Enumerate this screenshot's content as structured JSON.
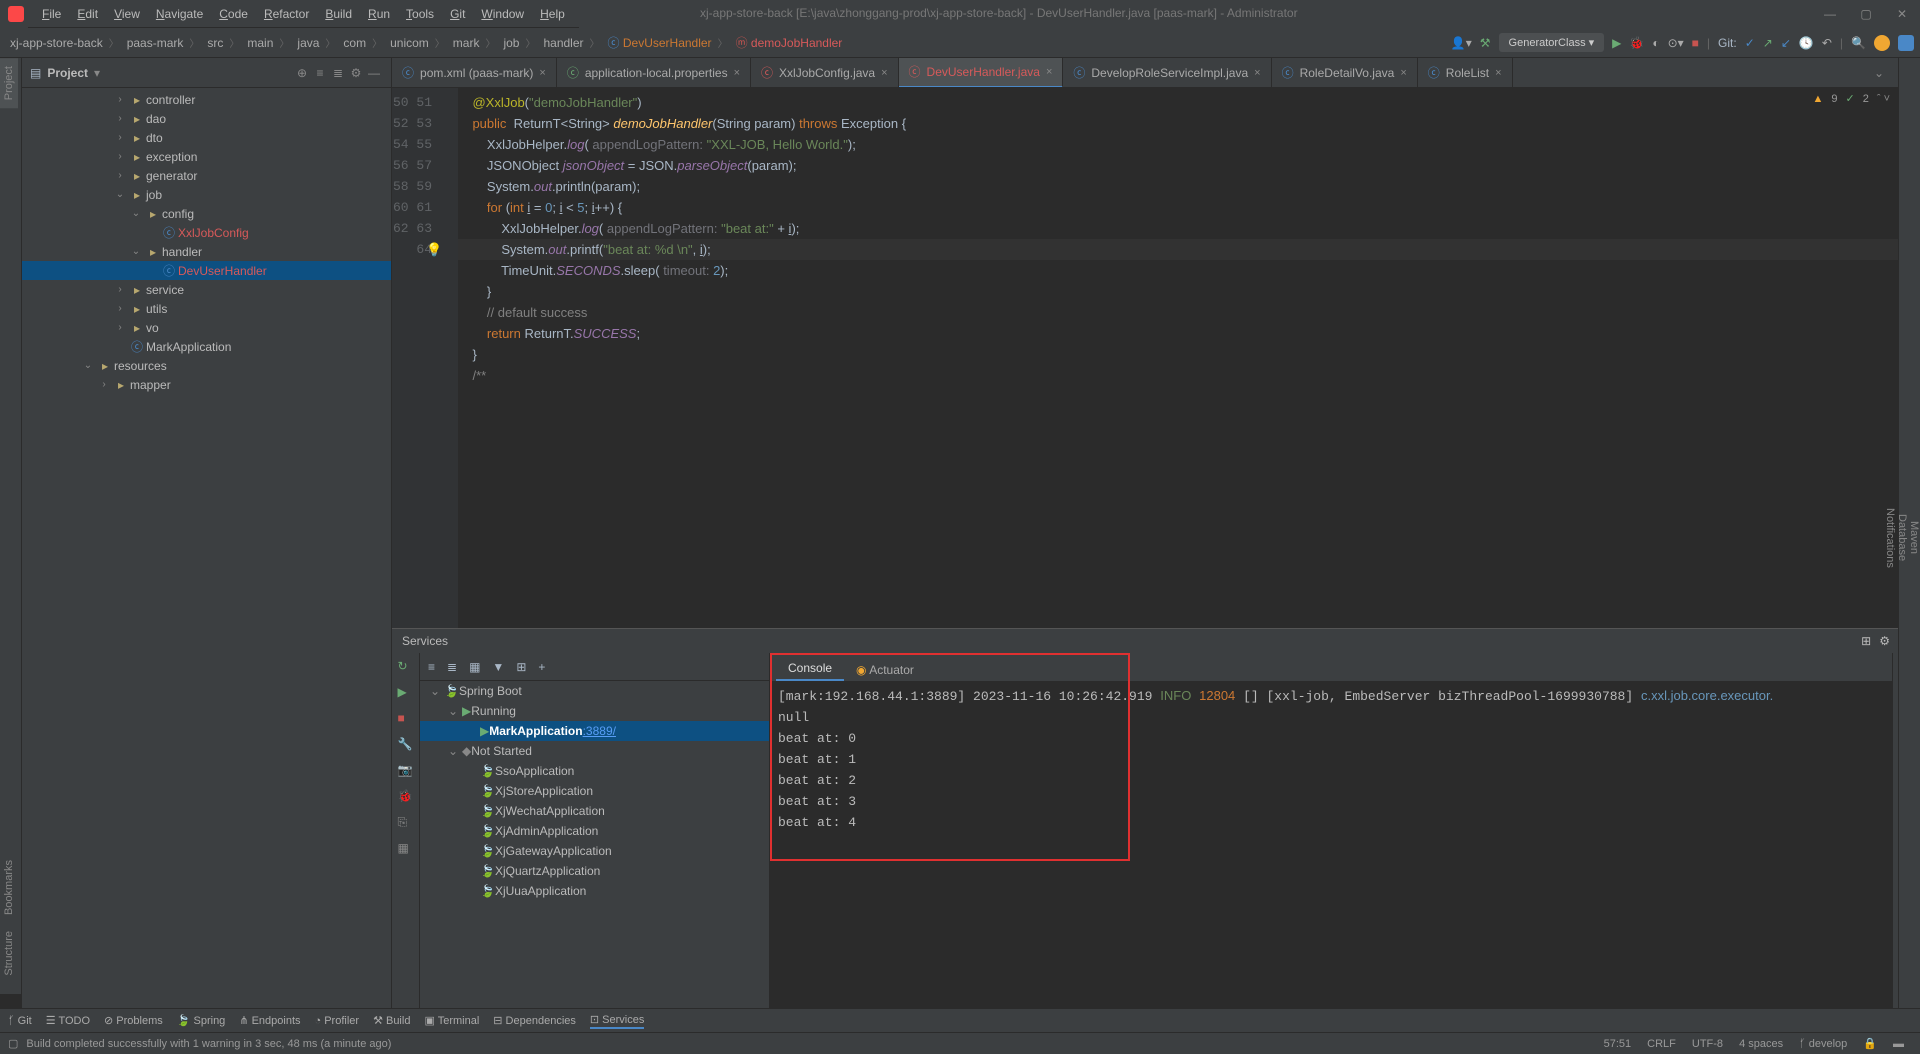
{
  "window": {
    "title": "xj-app-store-back [E:\\java\\zhonggang-prod\\xj-app-store-back] - DevUserHandler.java [paas-mark] - Administrator"
  },
  "menu": [
    "File",
    "Edit",
    "View",
    "Navigate",
    "Code",
    "Refactor",
    "Build",
    "Run",
    "Tools",
    "Git",
    "Window",
    "Help"
  ],
  "breadcrumbs": [
    "xj-app-store-back",
    "paas-mark",
    "src",
    "main",
    "java",
    "com",
    "unicom",
    "mark",
    "job",
    "handler",
    "DevUserHandler",
    "demoJobHandler"
  ],
  "run_config": "GeneratorClass",
  "git_label": "Git:",
  "project": {
    "title": "Project",
    "tree": [
      {
        "indent": 5,
        "arrow": ">",
        "icon": "dir",
        "label": "controller"
      },
      {
        "indent": 5,
        "arrow": ">",
        "icon": "dir",
        "label": "dao"
      },
      {
        "indent": 5,
        "arrow": ">",
        "icon": "dir",
        "label": "dto"
      },
      {
        "indent": 5,
        "arrow": ">",
        "icon": "dir",
        "label": "exception"
      },
      {
        "indent": 5,
        "arrow": ">",
        "icon": "dir",
        "label": "generator"
      },
      {
        "indent": 5,
        "arrow": "v",
        "icon": "dir",
        "label": "job"
      },
      {
        "indent": 6,
        "arrow": "v",
        "icon": "dir",
        "label": "config"
      },
      {
        "indent": 7,
        "arrow": "",
        "icon": "c",
        "label": "XxlJobConfig",
        "orange": true
      },
      {
        "indent": 6,
        "arrow": "v",
        "icon": "dir",
        "label": "handler"
      },
      {
        "indent": 7,
        "arrow": "",
        "icon": "c",
        "label": "DevUserHandler",
        "orange": true,
        "sel": true
      },
      {
        "indent": 5,
        "arrow": ">",
        "icon": "dir",
        "label": "service"
      },
      {
        "indent": 5,
        "arrow": ">",
        "icon": "dir",
        "label": "utils"
      },
      {
        "indent": 5,
        "arrow": ">",
        "icon": "dir",
        "label": "vo"
      },
      {
        "indent": 5,
        "arrow": "",
        "icon": "c",
        "label": "MarkApplication"
      },
      {
        "indent": 3,
        "arrow": "v",
        "icon": "dir",
        "label": "resources"
      },
      {
        "indent": 4,
        "arrow": ">",
        "icon": "dir",
        "label": "mapper"
      }
    ]
  },
  "tabs": [
    {
      "label": "pom.xml (paas-mark)",
      "color": "#4a88c7",
      "icon": "m"
    },
    {
      "label": "application-local.properties",
      "color": "#6aab73",
      "icon": "⚙"
    },
    {
      "label": "XxlJobConfig.java",
      "color": "#d75a5a",
      "icon": "c"
    },
    {
      "label": "DevUserHandler.java",
      "color": "#d75a5a",
      "icon": "c",
      "active": true
    },
    {
      "label": "DevelopRoleServiceImpl.java",
      "color": "#4a88c7",
      "icon": "c"
    },
    {
      "label": "RoleDetailVo.java",
      "color": "#4a88c7",
      "icon": "c"
    },
    {
      "label": "RoleList",
      "color": "#4a88c7",
      "icon": "c"
    }
  ],
  "editor_warnings": {
    "warn": "9",
    "ok": "2"
  },
  "code_lines": [
    {
      "n": 50,
      "html": "    <span class='ann'>@XxlJob</span>(<span class='str'>\"demoJobHandler\"</span>)"
    },
    {
      "n": 51,
      "html": "    <span class='kw'>public</span>  ReturnT&lt;String&gt; <span class='fn'>demoJobHandler</span>(String param) <span class='kw'>throws</span> Exception {"
    },
    {
      "n": 52,
      "html": "        XxlJobHelper.<span class='fld'>log</span>( <span class='param'>appendLogPattern:</span> <span class='str'>\"XXL-JOB, Hello World.\"</span>);"
    },
    {
      "n": 53,
      "html": "        JSONObject <span class='fld'>jsonObject</span> = JSON.<span class='fld'>parseObject</span>(param);"
    },
    {
      "n": 54,
      "html": "        System.<span class='fld'>out</span>.println(param);"
    },
    {
      "n": 55,
      "html": "        <span class='kw'>for</span> (<span class='kw'>int</span> <u>i</u> = <span class='num'>0</span>; <u>i</u> &lt; <span class='num'>5</span>; <u>i</u>++) {"
    },
    {
      "n": 56,
      "html": "            XxlJobHelper.<span class='fld'>log</span>( <span class='param'>appendLogPattern:</span> <span class='str'>\"beat at:\"</span> + <u>i</u>);"
    },
    {
      "n": 57,
      "html": "            System.<span class='fld'>out</span>.printf(<span class='str'>\"beat at: %d \\n\"</span>, <u>i</u>);",
      "hl": true,
      "bulb": true
    },
    {
      "n": 58,
      "html": "            TimeUnit.<span class='fld'>SECONDS</span>.sleep( <span class='param'>timeout:</span> <span class='num'>2</span>);"
    },
    {
      "n": 59,
      "html": "        }"
    },
    {
      "n": 60,
      "html": "        <span class='cmt'>// default success</span>"
    },
    {
      "n": 61,
      "html": "        <span class='kw'>return</span> ReturnT.<span class='fld'>SUCCESS</span>;"
    },
    {
      "n": 62,
      "html": "    }"
    },
    {
      "n": 63,
      "html": ""
    },
    {
      "n": 64,
      "html": "    <span class='cmt'>/**</span>"
    }
  ],
  "services": {
    "title": "Services",
    "console_tab": "Console",
    "actuator_tab": "Actuator",
    "tree": [
      {
        "indent": 0,
        "arrow": "v",
        "icon": "🍃",
        "label": "Spring Boot"
      },
      {
        "indent": 1,
        "arrow": "v",
        "icon": "▶",
        "label": "Running",
        "green": true
      },
      {
        "indent": 2,
        "arrow": "",
        "icon": "▶",
        "label": "MarkApplication",
        "link": ":3889/",
        "sel": true,
        "green": true,
        "bold": true
      },
      {
        "indent": 1,
        "arrow": "v",
        "icon": "◆",
        "label": "Not Started"
      },
      {
        "indent": 2,
        "arrow": "",
        "icon": "🍃",
        "label": "SsoApplication"
      },
      {
        "indent": 2,
        "arrow": "",
        "icon": "🍃",
        "label": "XjStoreApplication"
      },
      {
        "indent": 2,
        "arrow": "",
        "icon": "🍃",
        "label": "XjWechatApplication"
      },
      {
        "indent": 2,
        "arrow": "",
        "icon": "🍃",
        "label": "XjAdminApplication"
      },
      {
        "indent": 2,
        "arrow": "",
        "icon": "🍃",
        "label": "XjGatewayApplication"
      },
      {
        "indent": 2,
        "arrow": "",
        "icon": "🍃",
        "label": "XjQuartzApplication"
      },
      {
        "indent": 2,
        "arrow": "",
        "icon": "🍃",
        "label": "XjUuaApplication"
      }
    ],
    "console": "[mark:192.168.44.1:3889] 2023-11-16 10:26:42.919 <span class='log-info'>INFO</span> <span class='log-num'>12804</span> [] [xxl-job, EmbedServer bizThreadPool-1699930788] <span class='log-cls'>c.xxl.job.core.executor.</span>\nnull\nbeat at: 0\nbeat at: 1\nbeat at: 2\nbeat at: 3\nbeat at: 4"
  },
  "bottom_tabs": [
    "Git",
    "TODO",
    "Problems",
    "Spring",
    "Endpoints",
    "Profiler",
    "Build",
    "Terminal",
    "Dependencies",
    "Services"
  ],
  "status": {
    "msg": "Build completed successfully with 1 warning in 3 sec, 48 ms (a minute ago)",
    "pos": "57:51",
    "crlf": "CRLF",
    "enc": "UTF-8",
    "indent": "4 spaces",
    "branch": "develop"
  },
  "left_tabs": [
    "Project"
  ],
  "left_tabs_bottom": [
    "Bookmarks",
    "Structure"
  ],
  "right_tabs": [
    "Maven",
    "Database",
    "Notifications"
  ]
}
